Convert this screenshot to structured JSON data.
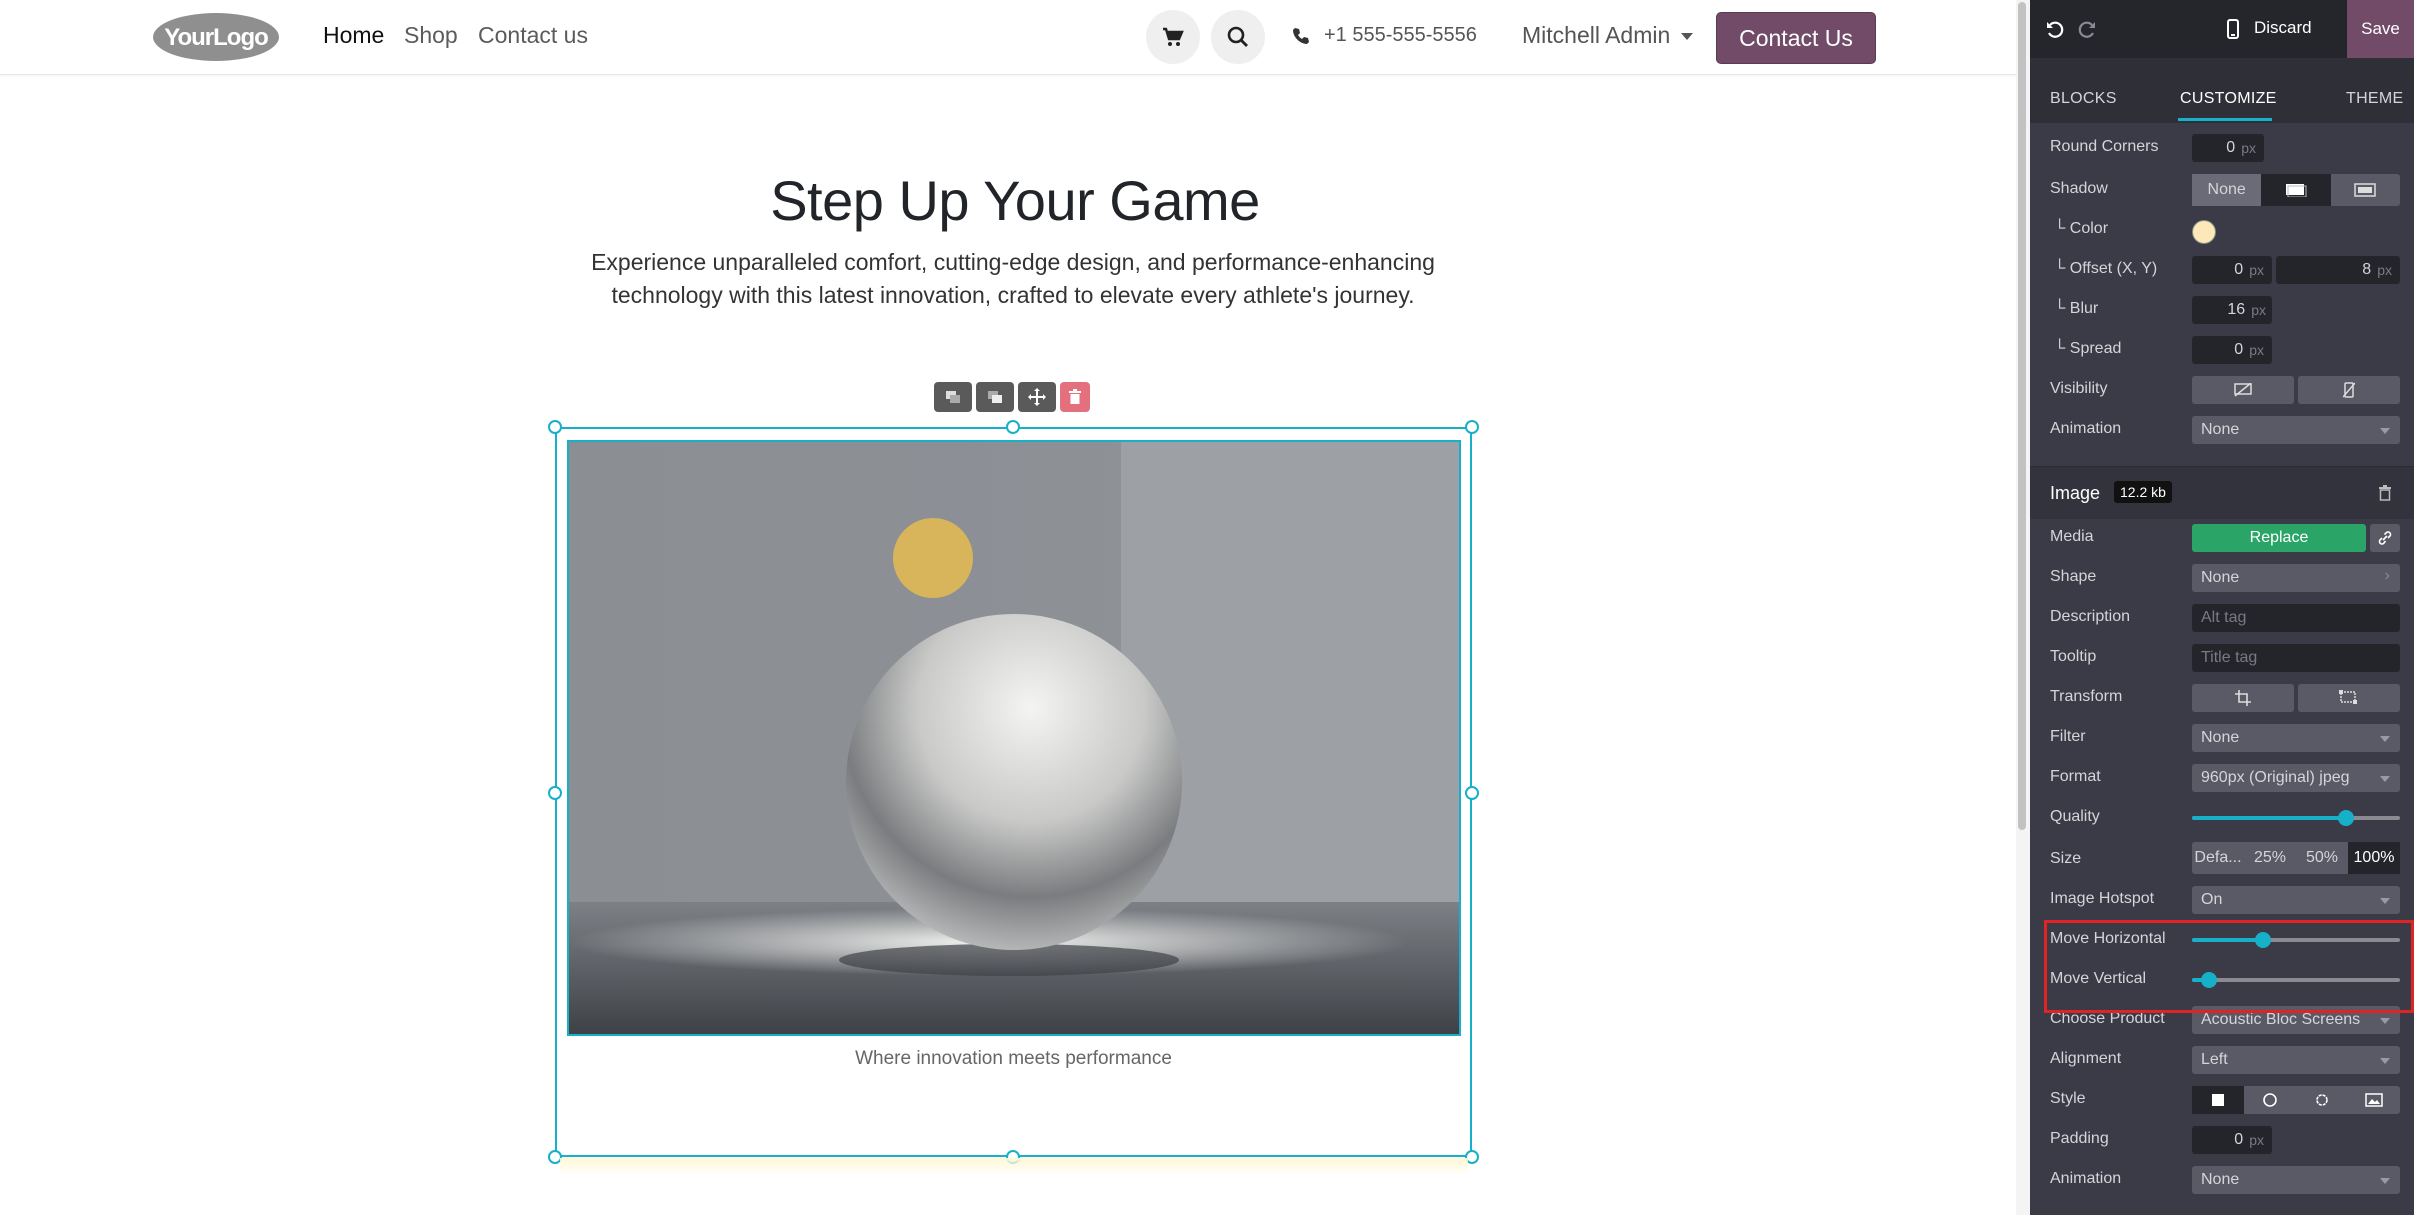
{
  "navbar": {
    "logo_text": "YourLogo",
    "links": [
      "Home",
      "Shop",
      "Contact us"
    ],
    "phone": "+1 555-555-5556",
    "user": "Mitchell Admin",
    "cta": "Contact Us"
  },
  "hero": {
    "title": "Step Up Your Game",
    "subtitle": "Experience unparalleled comfort, cutting-edge design, and performance-enhancing technology with this latest innovation, crafted to elevate every athlete's journey.",
    "caption": "Where innovation meets performance"
  },
  "editor": {
    "discard": "Discard",
    "save": "Save",
    "tabs": [
      "BLOCKS",
      "CUSTOMIZE",
      "THEME"
    ],
    "active_tab": "CUSTOMIZE",
    "block_options": {
      "round_corners": {
        "label": "Round Corners",
        "value": "0",
        "unit": "px"
      },
      "shadow": {
        "label": "Shadow",
        "none": "None"
      },
      "color": {
        "label": "└ Color",
        "swatch": "#fde9b8"
      },
      "offset": {
        "label": "└ Offset (X, Y)",
        "x": "0",
        "y": "8",
        "unit": "px"
      },
      "blur": {
        "label": "└ Blur",
        "value": "16",
        "unit": "px"
      },
      "spread": {
        "label": "└ Spread",
        "value": "0",
        "unit": "px"
      },
      "visibility": {
        "label": "Visibility"
      },
      "animation": {
        "label": "Animation",
        "value": "None"
      }
    },
    "image": {
      "title": "Image",
      "size": "12.2 kb",
      "media": {
        "label": "Media",
        "button": "Replace"
      },
      "shape": {
        "label": "Shape",
        "value": "None"
      },
      "description": {
        "label": "Description",
        "placeholder": "Alt tag"
      },
      "tooltip": {
        "label": "Tooltip",
        "placeholder": "Title tag"
      },
      "transform": {
        "label": "Transform"
      },
      "filter": {
        "label": "Filter",
        "value": "None"
      },
      "format": {
        "label": "Format",
        "value": "960px (Original) jpeg"
      },
      "quality": {
        "label": "Quality",
        "level": 0.74
      },
      "size_opt": {
        "label": "Size",
        "options": [
          "Defa...",
          "25%",
          "50%",
          "100%"
        ],
        "selected": "100%"
      },
      "hotspot": {
        "label": "Image Hotspot",
        "value": "On"
      },
      "move_h": {
        "label": "Move Horizontal",
        "level": 0.34
      },
      "move_v": {
        "label": "Move Vertical",
        "level": 0.08
      },
      "product": {
        "label": "Choose Product",
        "value": "Acoustic Bloc Screens"
      },
      "alignment": {
        "label": "Alignment",
        "value": "Left"
      },
      "style": {
        "label": "Style"
      },
      "padding": {
        "label": "Padding",
        "value": "0",
        "unit": "px"
      },
      "animation": {
        "label": "Animation",
        "value": "None"
      }
    }
  },
  "colors": {
    "brand": "#714b67",
    "accent": "#17b0c9",
    "highlight": "#e02424",
    "replace": "#2aa467"
  }
}
